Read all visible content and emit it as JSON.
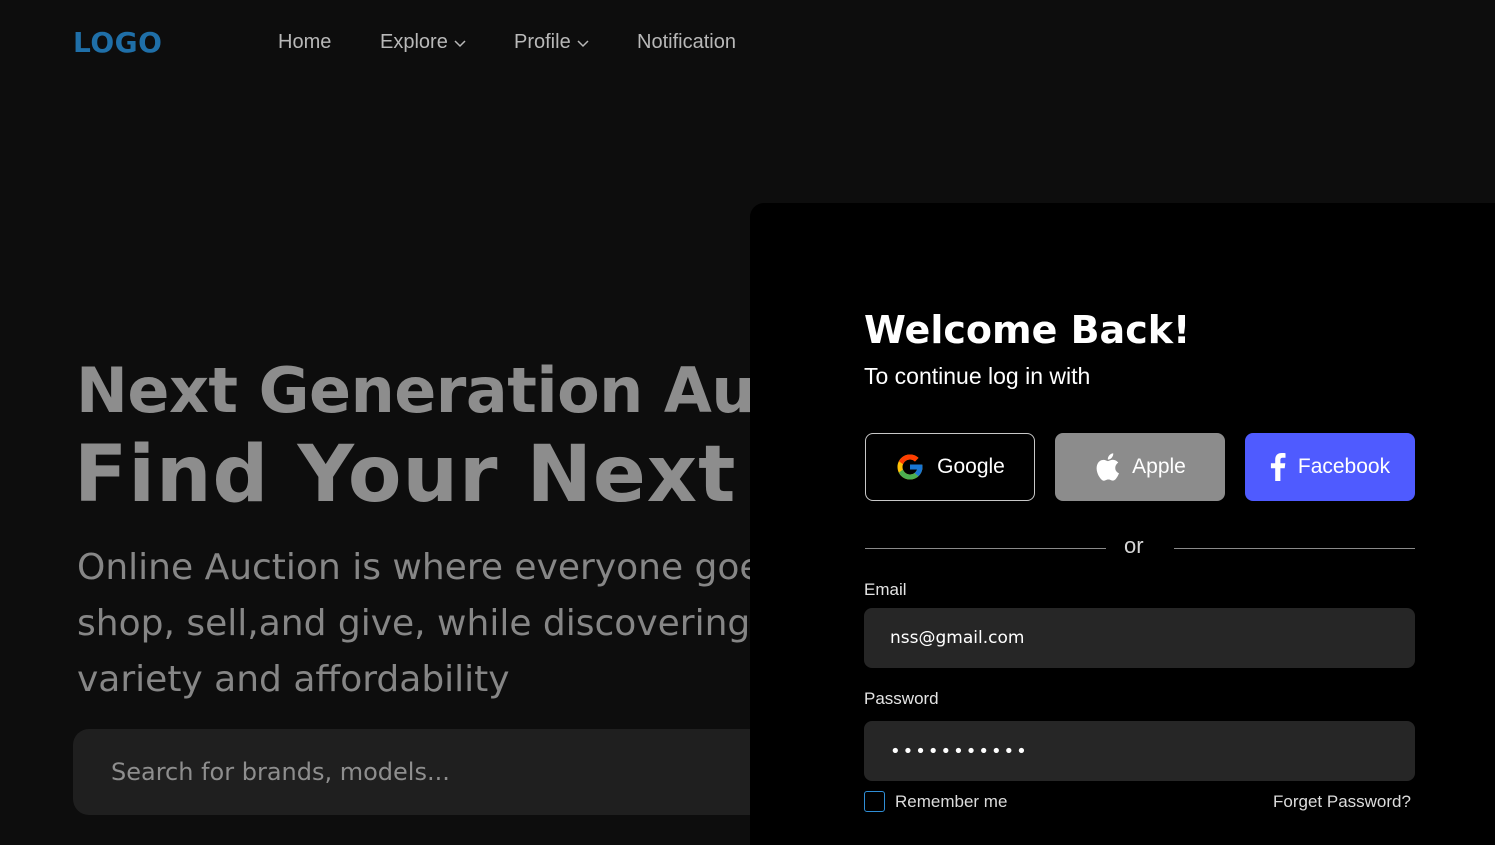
{
  "nav": {
    "logo": "LOGO",
    "items": [
      {
        "label": "Home"
      },
      {
        "label": "Explore"
      },
      {
        "label": "Profile"
      },
      {
        "label": "Notification"
      }
    ]
  },
  "hero": {
    "line1": "Next Generation Auction",
    "line2": "Find Your Next Deal",
    "description_lines": [
      "Online Auction is where everyone goes to",
      "shop, sell,and give, while discovering",
      "variety and affordability"
    ],
    "search_placeholder": "Search for brands, models..."
  },
  "login": {
    "title": "Welcome Back!",
    "subtitle": "To continue log in with",
    "social": {
      "google": "Google",
      "apple": "Apple",
      "facebook": "Facebook"
    },
    "or_label": "or",
    "email_label": "Email",
    "email_value": "nss@gmail.com",
    "password_label": "Password",
    "password_value": "•••••••••••",
    "remember_label": "Remember me",
    "forget_label": "Forget Password?"
  },
  "colors": {
    "background": "#0d0d0d",
    "panel": "#000000",
    "logo": "#1f6fa8",
    "facebook": "#4f5bff",
    "apple": "#8c8c8c",
    "field": "#262626",
    "checkbox_border": "#2f8ed6"
  },
  "icons": [
    "google-icon",
    "apple-icon",
    "facebook-icon",
    "chevron-down-icon"
  ]
}
